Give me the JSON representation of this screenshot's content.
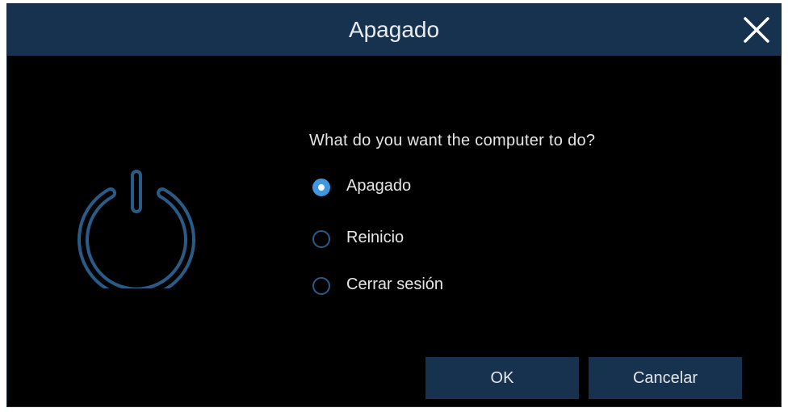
{
  "dialog": {
    "title": "Apagado",
    "question": "What do you want the computer to do?",
    "options": [
      {
        "label": "Apagado",
        "selected": true
      },
      {
        "label": "Reinicio",
        "selected": false
      },
      {
        "label": "Cerrar sesión",
        "selected": false
      }
    ],
    "ok_label": "OK",
    "cancel_label": "Cancelar"
  },
  "icons": {
    "close": "close-icon",
    "power": "power-icon"
  },
  "colors": {
    "titlebar": "#17324f",
    "background": "#000000",
    "accent": "#3f97e0",
    "icon": "#2a5b86",
    "text": "#e6e6e6"
  }
}
